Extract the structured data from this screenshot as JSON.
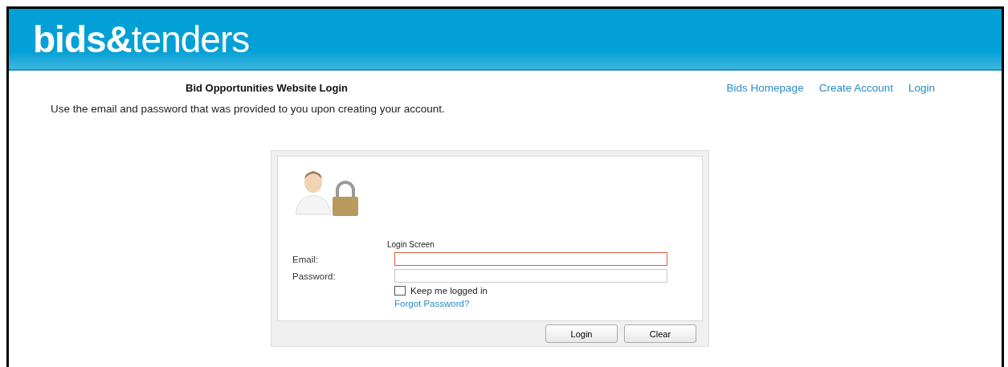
{
  "header": {
    "logo": "**bids&**tenders"
  },
  "page": {
    "title": "Bid Opportunities Website Login",
    "links": [
      {
        "label": "Bids Homepage"
      },
      {
        "label": "Create Account"
      },
      {
        "label": "Login"
      }
    ],
    "instructions": "Use the email and password that was provided to you upon creating your account."
  },
  "login_box": {
    "caption": "Login Screen",
    "fields": [
      {
        "label": "Email:",
        "error": true
      },
      {
        "label": "Password:",
        "error": false
      }
    ],
    "keep_logged_in": {
      "label": "Keep me logged in",
      "checked": false
    },
    "forgot_link": "Forgot Password?",
    "buttons": [
      "Login",
      "Clear"
    ]
  }
}
